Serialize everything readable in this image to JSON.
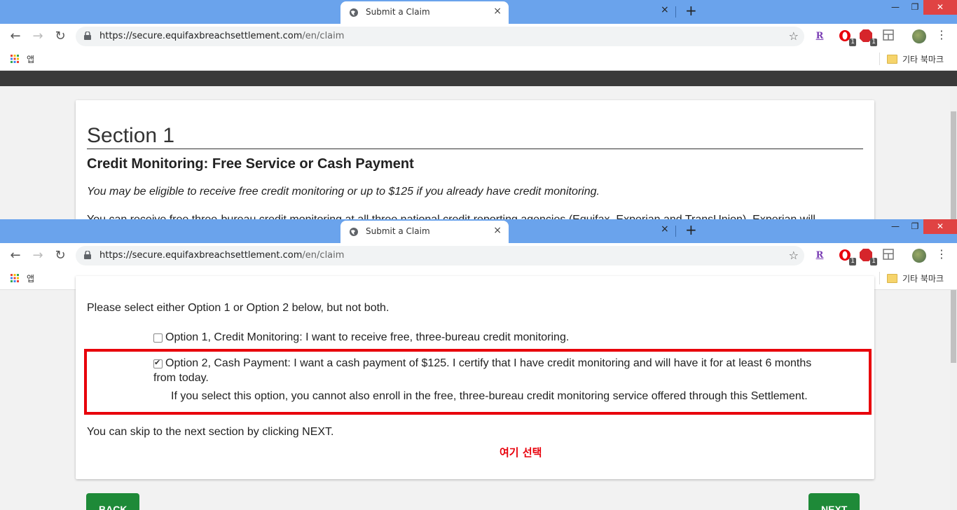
{
  "browser": {
    "tab_title": "Submit a Claim",
    "tab_close": "×",
    "ghost_tab_close": "×",
    "new_tab": "+",
    "window_controls": {
      "minimize": "—",
      "maximize": "❐",
      "close": "✕"
    },
    "url_host": "https://secure.equifaxbreachsettlement.com",
    "url_path": "/en/claim",
    "bookmarks": {
      "apps_label": "앱",
      "other_label": "기타 북마크"
    },
    "extensions": {
      "r_label": "R",
      "opera_badge": "1",
      "abp_badge": "1"
    }
  },
  "page_top": {
    "section_title": "Section 1",
    "heading": "Credit Monitoring: Free Service or Cash Payment",
    "lead": "You may be eligible to receive free credit monitoring or up to $125 if you already have credit monitoring.",
    "cut_line": "You can receive free three-bureau credit monitoring at all three national credit reporting agencies (Equifax, Experian and TransUnion). Experian will"
  },
  "page_bottom": {
    "faded_line": "",
    "instruction": "Please select either Option 1 or Option 2 below, but not both.",
    "option1_label": "Option 1, Credit Monitoring: I want to receive free, three-bureau credit monitoring.",
    "option1_checked": false,
    "option2_label_line1": "Option 2, Cash Payment: I want a cash payment of $125. I certify that I have credit monitoring and will have it for at least 6 months",
    "option2_label_line2": "from today.",
    "option2_checked": true,
    "option2_note": "If you select this option, you cannot also enroll in the free, three-bureau credit monitoring service offered through this Settlement.",
    "skip_text": "You can skip to the next section by clicking NEXT.",
    "annotation": "여기 선택",
    "back_label": "BACK",
    "next_label": "NEXT"
  },
  "colors": {
    "titlebar": "#6aa3ec",
    "accent_green": "#1e8a38",
    "highlight_red": "#e8000b"
  }
}
